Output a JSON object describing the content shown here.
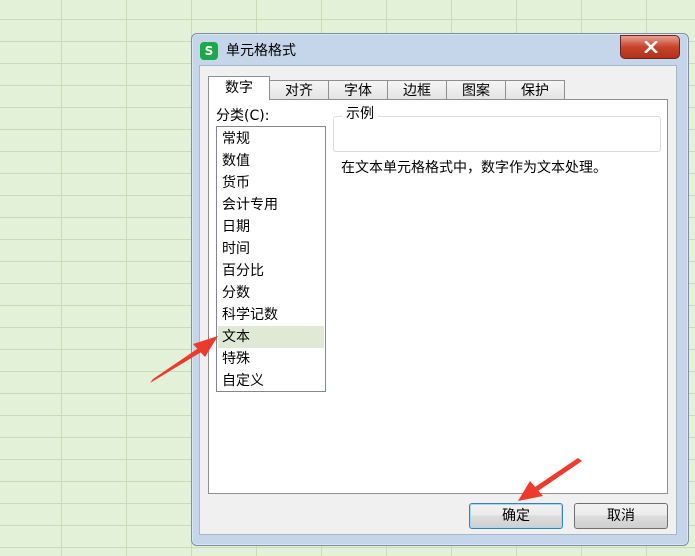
{
  "dialog": {
    "title": "单元格格式",
    "app_icon_letter": "S",
    "tabs": [
      {
        "label": "数字",
        "active": true
      },
      {
        "label": "对齐",
        "active": false
      },
      {
        "label": "字体",
        "active": false
      },
      {
        "label": "边框",
        "active": false
      },
      {
        "label": "图案",
        "active": false
      },
      {
        "label": "保护",
        "active": false
      }
    ],
    "category_label": "分类(C):",
    "categories": [
      {
        "label": "常规"
      },
      {
        "label": "数值"
      },
      {
        "label": "货币"
      },
      {
        "label": "会计专用"
      },
      {
        "label": "日期"
      },
      {
        "label": "时间"
      },
      {
        "label": "百分比"
      },
      {
        "label": "分数"
      },
      {
        "label": "科学记数"
      },
      {
        "label": "文本",
        "selected": true
      },
      {
        "label": "特殊"
      },
      {
        "label": "自定义"
      }
    ],
    "sample_label": "示例",
    "description": "在文本单元格格式中，数字作为文本处理。",
    "ok_label": "确定",
    "cancel_label": "取消"
  },
  "colors": {
    "annotation_arrow": "#ec3a2d",
    "selected_item_bg": "#dfe9d6",
    "app_icon_bg": "#1aa84a",
    "close_button": "#c7432a"
  }
}
